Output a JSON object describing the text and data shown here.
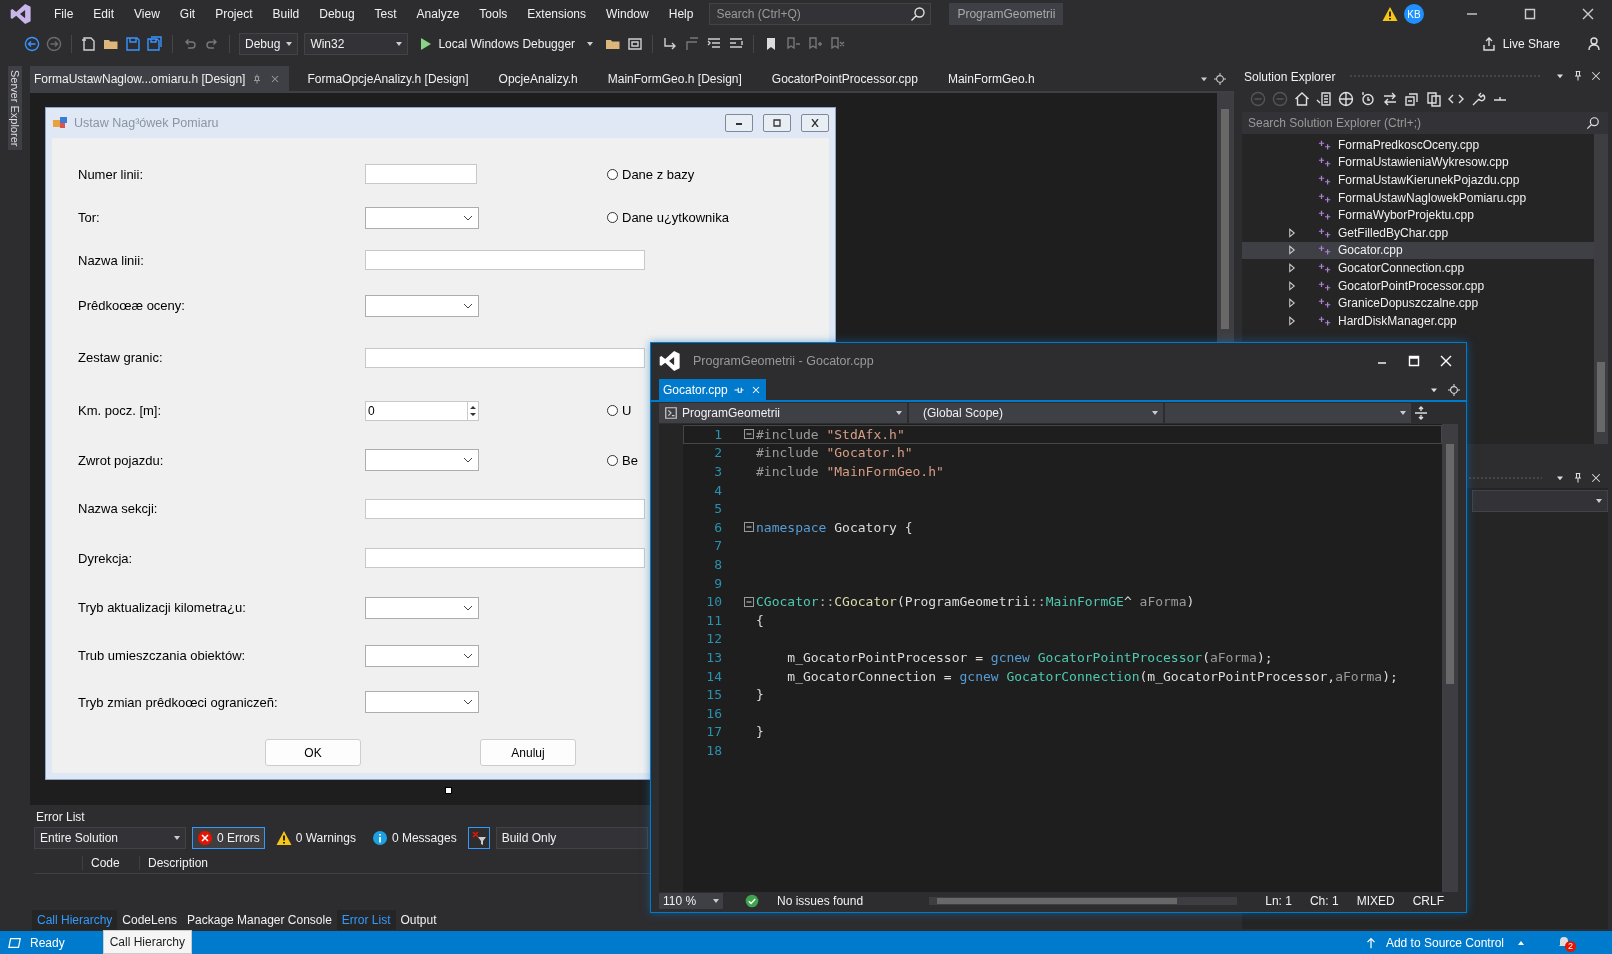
{
  "menu_bar": {
    "items": [
      "File",
      "Edit",
      "View",
      "Git",
      "Project",
      "Build",
      "Debug",
      "Test",
      "Analyze",
      "Tools",
      "Extensions",
      "Window",
      "Help"
    ],
    "search": {
      "placeholder": "Search (Ctrl+Q)"
    },
    "solution_name": "ProgramGeometrii",
    "account": "KB"
  },
  "toolbar": {
    "configuration": "Debug",
    "platform": "Win32",
    "run_target": "Local Windows Debugger",
    "live_share": "Live Share"
  },
  "side_strip": {
    "label": "Server Explorer"
  },
  "doc_tabs": [
    {
      "label": "FormaUstawNaglow...omiaru.h [Design]",
      "selected": true
    },
    {
      "label": "FormaOpcjeAnalizy.h [Design]",
      "selected": false
    },
    {
      "label": "OpcjeAnalizy.h",
      "selected": false
    },
    {
      "label": "MainFormGeo.h [Design]",
      "selected": false
    },
    {
      "label": "GocatorPointProcessor.cpp",
      "selected": false
    },
    {
      "label": "MainFormGeo.h",
      "selected": false
    }
  ],
  "designer_form": {
    "title": "Ustaw Nag³ówek Pomiaru",
    "fields": [
      {
        "label": "Numer linii:",
        "kind": "text",
        "radio": {
          "label": "Dane z bazy",
          "selected": false
        }
      },
      {
        "label": "Tor:",
        "kind": "combo",
        "radio": {
          "label": "Dane u¿ytkownika",
          "selected": false
        }
      },
      {
        "label": "Nazwa linii:",
        "kind": "wide"
      },
      {
        "label": "Prêdkoœæ oceny:",
        "kind": "combo"
      },
      {
        "label": "Zestaw granic:",
        "kind": "wide"
      },
      {
        "label": "Km. pocz. [m]:",
        "kind": "spin",
        "value": "0",
        "radio": {
          "label": "U",
          "selected": false
        }
      },
      {
        "label": "Zwrot pojazdu:",
        "kind": "combo",
        "radio": {
          "label": "Be",
          "selected": false
        }
      },
      {
        "label": "Nazwa sekcji:",
        "kind": "wide"
      },
      {
        "label": "Dyrekcja:",
        "kind": "wide"
      },
      {
        "label": "Tryb aktualizacji kilometra¿u:",
        "kind": "combo"
      },
      {
        "label": "Trub umieszczania obiektów:",
        "kind": "combo"
      },
      {
        "label": "Tryb zmian prêdkoœci ograniczeñ:",
        "kind": "combo"
      }
    ],
    "buttons": [
      "OK",
      "Anuluj"
    ]
  },
  "error_list": {
    "title": "Error List",
    "scope": "Entire Solution",
    "filters": [
      {
        "label": "0 Errors",
        "kind": "error",
        "selected": true
      },
      {
        "label": "0 Warnings",
        "kind": "warning",
        "selected": false
      },
      {
        "label": "0 Messages",
        "kind": "info",
        "selected": false
      }
    ],
    "build_filter": "Build Only",
    "columns": [
      "Code",
      "Description"
    ]
  },
  "bottom_tabs": [
    {
      "label": "Call Hierarchy",
      "selected": true
    },
    {
      "label": "CodeLens",
      "selected": false
    },
    {
      "label": "Package Manager Console",
      "selected": false
    },
    {
      "label": "Error List",
      "selected": true
    },
    {
      "label": "Output",
      "selected": false
    }
  ],
  "solution_explorer": {
    "title": "Solution Explorer",
    "search": {
      "placeholder": "Search Solution Explorer (Ctrl+;)"
    },
    "items": [
      {
        "label": "FormaPredkoscOceny.cpp",
        "expandable": false,
        "selected": false
      },
      {
        "label": "FormaUstawieniaWykresow.cpp",
        "expandable": false,
        "selected": false
      },
      {
        "label": "FormaUstawKierunekPojazdu.cpp",
        "expandable": false,
        "selected": false
      },
      {
        "label": "FormaUstawNaglowekPomiaru.cpp",
        "expandable": false,
        "selected": false
      },
      {
        "label": "FormaWyborProjektu.cpp",
        "expandable": false,
        "selected": false
      },
      {
        "label": "GetFilledByChar.cpp",
        "expandable": true,
        "selected": false
      },
      {
        "label": "Gocator.cpp",
        "expandable": true,
        "selected": true
      },
      {
        "label": "GocatorConnection.cpp",
        "expandable": true,
        "selected": false
      },
      {
        "label": "GocatorPointProcessor.cpp",
        "expandable": true,
        "selected": false
      },
      {
        "label": "GraniceDopuszczalne.cpp",
        "expandable": true,
        "selected": false
      },
      {
        "label": "HardDiskManager.cpp",
        "expandable": true,
        "selected": false
      }
    ]
  },
  "editor_window": {
    "title": "ProgramGeometrii - Gocator.cpp",
    "tab": "Gocator.cpp",
    "project": "ProgramGeometrii",
    "scope": "(Global Scope)",
    "lines": [
      {
        "number": "1",
        "fold": true,
        "current": true,
        "tokens": [
          {
            "text": "#include ",
            "kind": "pre"
          },
          {
            "text": "\"StdAfx.h\"",
            "kind": "string"
          }
        ]
      },
      {
        "number": "2",
        "fold": false,
        "current": false,
        "tokens": [
          {
            "text": "#include ",
            "kind": "pre"
          },
          {
            "text": "\"Gocator.h\"",
            "kind": "string"
          }
        ]
      },
      {
        "number": "3",
        "fold": false,
        "current": false,
        "tokens": [
          {
            "text": "#include ",
            "kind": "pre"
          },
          {
            "text": "\"MainFormGeo.h\"",
            "kind": "string"
          }
        ]
      },
      {
        "number": "4",
        "fold": false,
        "current": false
      },
      {
        "number": "5",
        "fold": false,
        "current": false
      },
      {
        "number": "6",
        "fold": true,
        "current": false,
        "tokens": [
          {
            "text": "namespace",
            "kind": "keyword"
          },
          {
            "text": " Gocatory {",
            "kind": "plain"
          }
        ]
      },
      {
        "number": "7",
        "fold": false,
        "current": false
      },
      {
        "number": "8",
        "fold": false,
        "current": false
      },
      {
        "number": "9",
        "fold": false,
        "current": false
      },
      {
        "number": "10",
        "fold": true,
        "current": false,
        "tokens": [
          {
            "text": "CGocator",
            "kind": "type"
          },
          {
            "text": "::",
            "kind": "punct"
          },
          {
            "text": "CGocator",
            "kind": "func"
          },
          {
            "text": "(ProgramGeometrii",
            "kind": "plain"
          },
          {
            "text": "::",
            "kind": "punct"
          },
          {
            "text": "MainFormGE",
            "kind": "type"
          },
          {
            "text": "^ ",
            "kind": "plain"
          },
          {
            "text": "aForma",
            "kind": "param"
          },
          {
            "text": ")",
            "kind": "plain"
          }
        ]
      },
      {
        "number": "11",
        "fold": false,
        "current": false,
        "tokens": [
          {
            "text": "{",
            "kind": "plain"
          }
        ]
      },
      {
        "number": "12",
        "fold": false,
        "current": false
      },
      {
        "number": "13",
        "fold": false,
        "current": false,
        "tokens": [
          {
            "text": "    m_GocatorPointProcessor = ",
            "kind": "plain"
          },
          {
            "text": "gcnew",
            "kind": "keyword"
          },
          {
            "text": " GocatorPointProcessor",
            "kind": "type"
          },
          {
            "text": "(",
            "kind": "plain"
          },
          {
            "text": "aForma",
            "kind": "param"
          },
          {
            "text": ");",
            "kind": "plain"
          }
        ]
      },
      {
        "number": "14",
        "fold": false,
        "current": false,
        "tokens": [
          {
            "text": "    m_GocatorConnection = ",
            "kind": "plain"
          },
          {
            "text": "gcnew",
            "kind": "keyword"
          },
          {
            "text": " GocatorConnection",
            "kind": "type"
          },
          {
            "text": "(m_GocatorPointProcessor,",
            "kind": "plain"
          },
          {
            "text": "aForma",
            "kind": "param"
          },
          {
            "text": ");",
            "kind": "plain"
          }
        ]
      },
      {
        "number": "15",
        "fold": false,
        "current": false,
        "tokens": [
          {
            "text": "}",
            "kind": "plain"
          }
        ]
      },
      {
        "number": "16",
        "fold": false,
        "current": false
      },
      {
        "number": "17",
        "fold": false,
        "current": false,
        "tokens": [
          {
            "text": "}",
            "kind": "plain"
          }
        ]
      },
      {
        "number": "18",
        "fold": false,
        "current": false
      }
    ],
    "status": {
      "zoom": "110 %",
      "issues": "No issues found",
      "line": "Ln: 1",
      "column": "Ch: 1",
      "indentation": "MIXED",
      "line_endings": "CRLF"
    }
  },
  "status_bar": {
    "state": "Ready",
    "tooltip": "Call Hierarchy",
    "source_control": "Add to Source Control",
    "notifications": "2"
  }
}
